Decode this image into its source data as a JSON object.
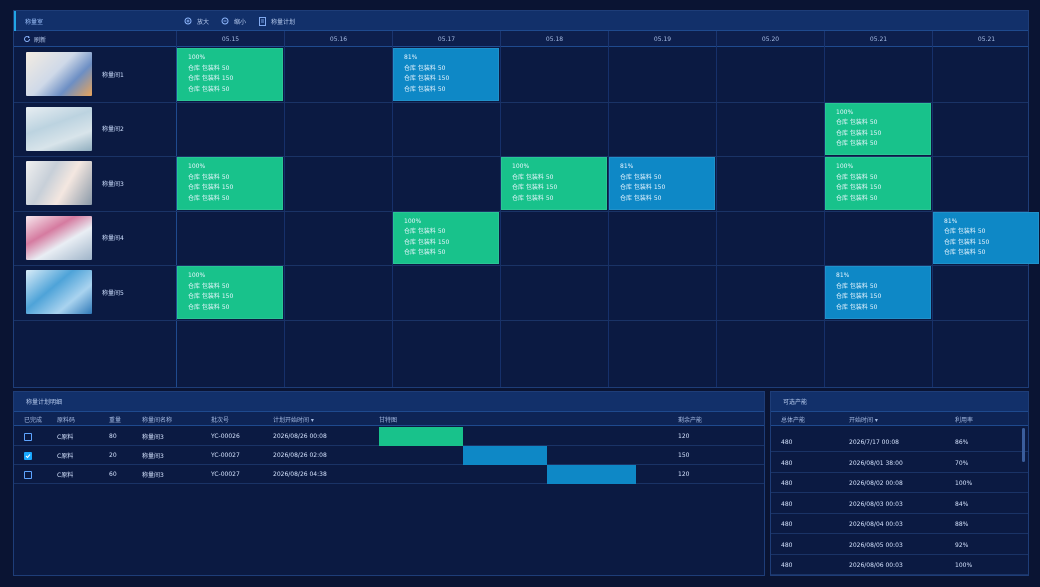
{
  "toolbar": {
    "title": "称量室",
    "actions": [
      {
        "label": "放大",
        "icon": "zoom-in-icon"
      },
      {
        "label": "缩小",
        "icon": "zoom-out-icon"
      },
      {
        "label": "称量计划",
        "icon": "document-icon"
      }
    ]
  },
  "schedule": {
    "refresh_label": "刷新",
    "dates": [
      "05.15",
      "05.16",
      "05.17",
      "05.18",
      "05.19",
      "05.20",
      "05.21",
      "05.21"
    ],
    "resources": [
      {
        "label": "称量间1",
        "tasks": [
          {
            "col": 0,
            "color": "green",
            "pct": "100%",
            "lines": [
              "仓库  包装料  50",
              "仓库  包装料  150",
              "仓库  包装料  50"
            ]
          },
          {
            "col": 2,
            "color": "blue",
            "pct": "81%",
            "lines": [
              "仓库  包装料  50",
              "仓库  包装料  150",
              "仓库  包装料  50"
            ]
          }
        ]
      },
      {
        "label": "称量间2",
        "tasks": [
          {
            "col": 6,
            "color": "green",
            "pct": "100%",
            "lines": [
              "仓库  包装料  50",
              "仓库  包装料  150",
              "仓库  包装料  50"
            ]
          }
        ]
      },
      {
        "label": "称量间3",
        "tasks": [
          {
            "col": 0,
            "color": "green",
            "pct": "100%",
            "lines": [
              "仓库  包装料  50",
              "仓库  包装料  150",
              "仓库  包装料  50"
            ]
          },
          {
            "col": 3,
            "color": "green",
            "pct": "100%",
            "lines": [
              "仓库  包装料  50",
              "仓库  包装料  150",
              "仓库  包装料  50"
            ]
          },
          {
            "col": 4,
            "color": "blue",
            "pct": "81%",
            "lines": [
              "仓库  包装料  50",
              "仓库  包装料  150",
              "仓库  包装料  50"
            ]
          },
          {
            "col": 6,
            "color": "green",
            "pct": "100%",
            "lines": [
              "仓库  包装料  50",
              "仓库  包装料  150",
              "仓库  包装料  50"
            ]
          }
        ]
      },
      {
        "label": "称量间4",
        "tasks": [
          {
            "col": 2,
            "color": "green",
            "pct": "100%",
            "lines": [
              "仓库  包装料  50",
              "仓库  包装料  150",
              "仓库  包装料  50"
            ]
          },
          {
            "col": 7,
            "color": "blue",
            "pct": "81%",
            "lines": [
              "仓库  包装料  50",
              "仓库  包装料  150",
              "仓库  包装料  50"
            ]
          }
        ]
      },
      {
        "label": "称量间5",
        "tasks": [
          {
            "col": 0,
            "color": "green",
            "pct": "100%",
            "lines": [
              "仓库  包装料  50",
              "仓库  包装料  150",
              "仓库  包装料  50"
            ]
          },
          {
            "col": 6,
            "color": "blue",
            "pct": "81%",
            "lines": [
              "仓库  包装料  50",
              "仓库  包装料  150",
              "仓库  包装料  50"
            ]
          }
        ]
      }
    ]
  },
  "detail": {
    "title": "称量计划明细",
    "headers": [
      "已完成",
      "原料码",
      "重量",
      "称量间名称",
      "批次号",
      "计划开始时间 ▾",
      "甘特图",
      "剩余产能"
    ],
    "rows": [
      {
        "checked": false,
        "code": "C原料",
        "weight": "80",
        "room": "称量间3",
        "batch": "YC-00026",
        "start": "2026/08/26 00:08",
        "capacity": "120",
        "color": "green"
      },
      {
        "checked": true,
        "code": "C原料",
        "weight": "20",
        "room": "称量间3",
        "batch": "YC-00027",
        "start": "2026/08/26 02:08",
        "capacity": "150",
        "color": "blue"
      },
      {
        "checked": false,
        "code": "C原料",
        "weight": "60",
        "room": "称量间3",
        "batch": "YC-00027",
        "start": "2026/08/26 04:38",
        "capacity": "120",
        "color": "blue"
      }
    ]
  },
  "capacity": {
    "title": "可选产能",
    "headers": [
      "总体产能",
      "开始时间 ▾",
      "利用率"
    ],
    "rows": [
      {
        "total": "480",
        "start": "2026/7/17 00:08",
        "rate": "86%"
      },
      {
        "total": "480",
        "start": "2026/08/01 38:00",
        "rate": "70%"
      },
      {
        "total": "480",
        "start": "2026/08/02 00:08",
        "rate": "100%"
      },
      {
        "total": "480",
        "start": "2026/08/03 00:03",
        "rate": "84%"
      },
      {
        "total": "480",
        "start": "2026/08/04 00:03",
        "rate": "88%"
      },
      {
        "total": "480",
        "start": "2026/08/05 00:03",
        "rate": "92%"
      },
      {
        "total": "480",
        "start": "2026/08/06 00:03",
        "rate": "100%"
      }
    ]
  },
  "colors": {
    "green": "#18c28b",
    "blue": "#0e88c6",
    "accent": "#21a6e6"
  }
}
